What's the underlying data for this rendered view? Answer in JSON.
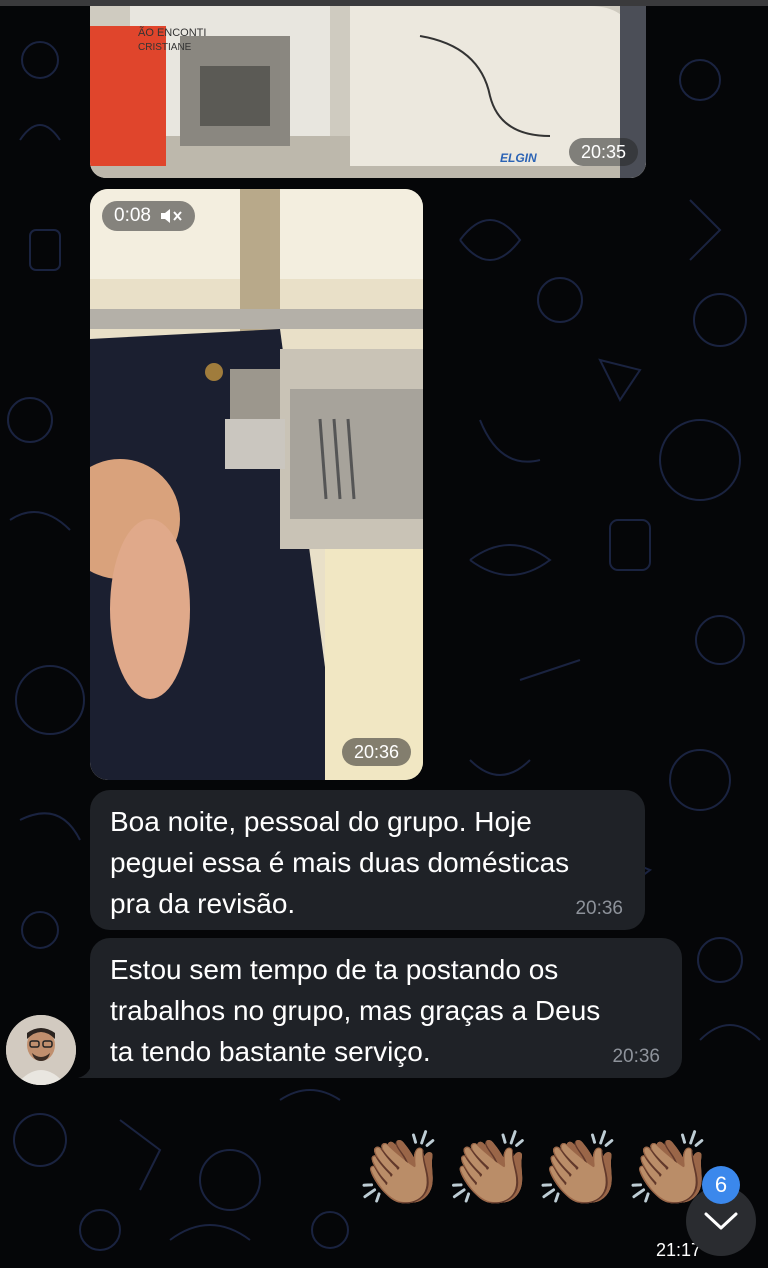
{
  "colors": {
    "background": "#050608",
    "bubble": "#1f2227",
    "timestamp": "#8e939b",
    "badge": "#3b88ec"
  },
  "messages": {
    "photo": {
      "time": "20:35",
      "sign_text_1": "ÃO ENCONTI",
      "sign_text_2": "CRISTIANE",
      "brand": "ELGIN"
    },
    "video": {
      "duration": "0:08",
      "time": "20:36",
      "muted_icon": "speaker-muted-icon"
    },
    "text1": {
      "text": "Boa noite, pessoal do grupo. Hoje\npeguei essa é mais duas domésticas\npra da revisão.",
      "time": "20:36"
    },
    "text2": {
      "text": "Estou sem tempo de ta postando os\ntrabalhos no grupo, mas graças a Deus\nta tendo bastante serviço.",
      "time": "20:36"
    },
    "emoji": {
      "content": "👏🏽👏🏽👏🏽👏🏽",
      "time": "21:17"
    }
  },
  "scroll_to_bottom": {
    "unread_count": "6",
    "icon": "chevron-down-icon"
  },
  "avatar": {
    "icon": "user-avatar"
  }
}
